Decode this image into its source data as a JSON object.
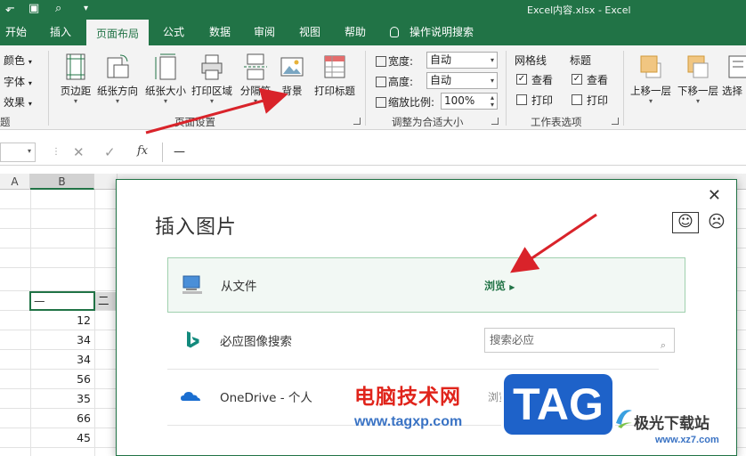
{
  "window": {
    "title": "Excel内容.xlsx  -  Excel"
  },
  "tabs": [
    "开始",
    "插入",
    "页面布局",
    "公式",
    "数据",
    "审阅",
    "视图",
    "帮助",
    "操作说明搜索"
  ],
  "ribbon": {
    "theme_small": [
      "颜色",
      "字体",
      "效果"
    ],
    "page_setup_buttons": [
      "页边距",
      "纸张方向",
      "纸张大小",
      "打印区域",
      "分隔符",
      "背景",
      "打印标题"
    ],
    "page_setup_group": "页面设置",
    "scale_group": {
      "width_label": "宽度:",
      "width_value": "自动",
      "height_label": "高度:",
      "height_value": "自动",
      "scale_label": "缩放比例:",
      "scale_value": "100%",
      "label": "调整为合适大小"
    },
    "sheet_options": {
      "gridlines": "网格线",
      "headings": "标题",
      "view": "查看",
      "print": "打印",
      "label": "工作表选项"
    },
    "arrange": [
      "上移一层",
      "下移一层",
      "选择"
    ],
    "theme_group_tail": "题"
  },
  "formula_bar": {
    "fx": "fx",
    "value": "—"
  },
  "grid": {
    "col_a": "A",
    "col_b": "B",
    "row_header_b": "—",
    "row_header_c": "二",
    "values": [
      "12",
      "34",
      "34",
      "56",
      "35",
      "66",
      "45"
    ]
  },
  "dialog": {
    "title": "插入图片",
    "from_file": "从文件",
    "browse": "浏览",
    "bing": "必应图像搜索",
    "search_placeholder": "搜索必应",
    "onedrive": "OneDrive - 个人",
    "onedrive_browse": "浏览"
  },
  "watermark": {
    "site_cn": "电脑技术网",
    "site_url": "www.tagxp.com",
    "tag": "TAG",
    "site2_cn": "极光下载站",
    "site2_url": "www.xz7.com"
  },
  "colors": {
    "excel_green": "#217346",
    "arrow_red": "#d9232a"
  }
}
